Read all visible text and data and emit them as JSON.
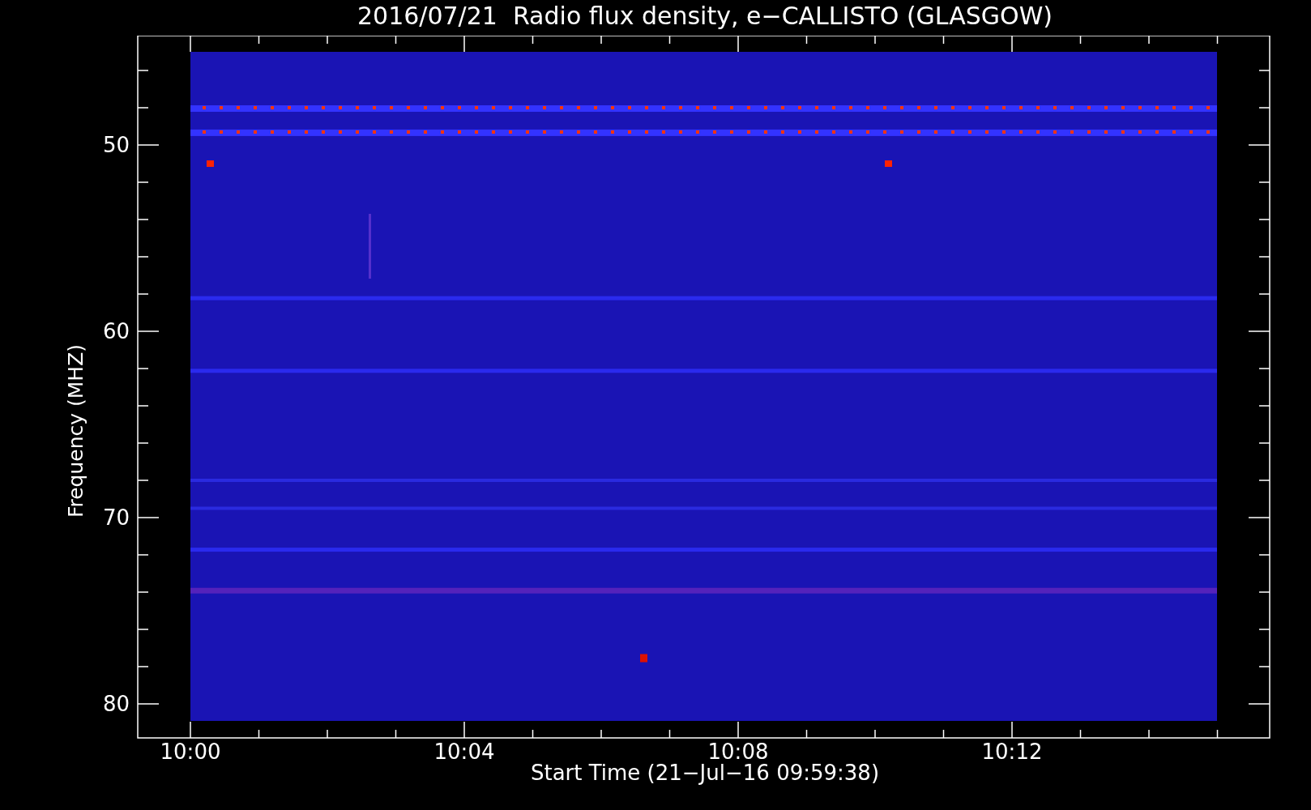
{
  "plot": {
    "title": "2016/07/21  Radio flux density, e−CALLISTO (GLASGOW)",
    "xlabel": "Start Time (21−Jul−16 09:59:38)",
    "ylabel": "Frequency (MHZ)",
    "xticks": [
      "10:00",
      "10:04",
      "10:08",
      "10:12"
    ],
    "yticks": [
      "50",
      "60",
      "70",
      "80"
    ]
  }
}
